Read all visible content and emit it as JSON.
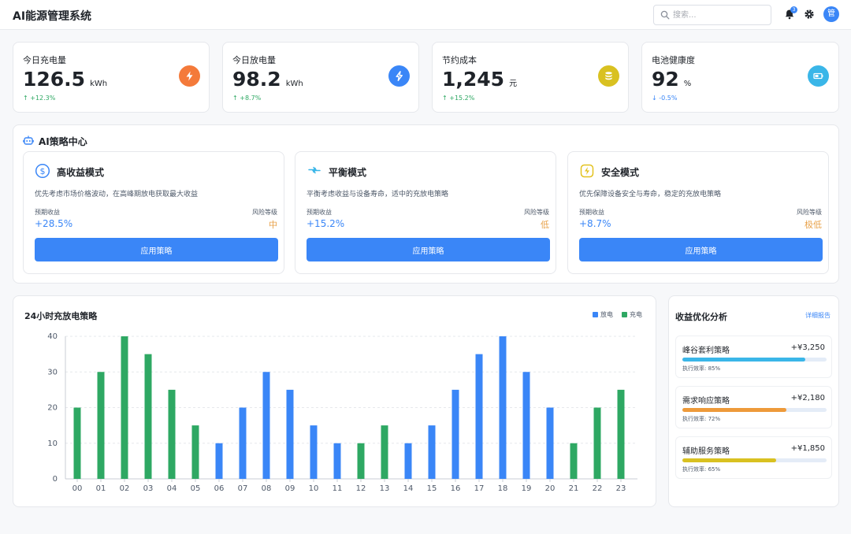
{
  "app": {
    "title": "AI能源管理系统"
  },
  "header": {
    "search_placeholder": "搜索...",
    "notification_count": "3",
    "avatar_text": "管"
  },
  "stats": [
    {
      "label": "今日充电量",
      "value": "126.5",
      "unit": "kWh",
      "trend": "+12.3%",
      "direction": "up",
      "icon": "bolt-icon",
      "color": "#f47a3a"
    },
    {
      "label": "今日放电量",
      "value": "98.2",
      "unit": "kWh",
      "trend": "+8.7%",
      "direction": "up",
      "icon": "flash-icon",
      "color": "#3a86f7"
    },
    {
      "label": "节约成本",
      "value": "1,245",
      "unit": "元",
      "trend": "+15.2%",
      "direction": "up",
      "icon": "coins-icon",
      "color": "#d9c121"
    },
    {
      "label": "电池健康度",
      "value": "92",
      "unit": "%",
      "trend": "-0.5%",
      "direction": "down",
      "icon": "battery-icon",
      "color": "#3ab6e8"
    }
  ],
  "ai_center": {
    "title": "AI策略中心",
    "strategies": [
      {
        "title": "高收益模式",
        "icon": "dollar-icon",
        "icon_color": "#3a86f7",
        "desc": "优先考虑市场价格波动，在高峰期放电获取最大收益",
        "income_label": "预期收益",
        "income": "+28.5%",
        "risk_label": "风险等级",
        "risk": "中",
        "button": "应用策略"
      },
      {
        "title": "平衡模式",
        "icon": "arrows-exchange-icon",
        "icon_color": "#3ab6e8",
        "desc": "平衡考虑收益与设备寿命，适中的充放电策略",
        "income_label": "预期收益",
        "income": "+15.2%",
        "risk_label": "风险等级",
        "risk": "低",
        "button": "应用策略"
      },
      {
        "title": "安全模式",
        "icon": "shield-bolt-icon",
        "icon_color": "#e3c21f",
        "desc": "优先保障设备安全与寿命，稳定的充放电策略",
        "income_label": "预期收益",
        "income": "+8.7%",
        "risk_label": "风险等级",
        "risk": "极低",
        "button": "应用策略"
      }
    ]
  },
  "chart": {
    "title": "24小时充放电策略",
    "legend": [
      {
        "name": "放电",
        "color": "#3a86f7"
      },
      {
        "name": "充电",
        "color": "#2ea863"
      }
    ]
  },
  "chart_data": {
    "type": "bar",
    "title": "24小时充放电策略",
    "categories": [
      "00",
      "01",
      "02",
      "03",
      "04",
      "05",
      "06",
      "07",
      "08",
      "09",
      "10",
      "11",
      "12",
      "13",
      "14",
      "15",
      "16",
      "17",
      "18",
      "19",
      "20",
      "21",
      "22",
      "23"
    ],
    "values": [
      20,
      30,
      40,
      35,
      25,
      15,
      10,
      20,
      30,
      25,
      15,
      10,
      10,
      15,
      10,
      15,
      25,
      35,
      40,
      30,
      20,
      10,
      20,
      25
    ],
    "bar_series": [
      "充电",
      "充电",
      "充电",
      "充电",
      "充电",
      "充电",
      "放电",
      "放电",
      "放电",
      "放电",
      "放电",
      "放电",
      "充电",
      "充电",
      "放电",
      "放电",
      "放电",
      "放电",
      "放电",
      "放电",
      "放电",
      "充电",
      "充电",
      "充电"
    ],
    "series": [
      {
        "name": "放电",
        "color": "#3a86f7"
      },
      {
        "name": "充电",
        "color": "#2ea863"
      }
    ],
    "yticks": [
      0,
      10,
      20,
      30,
      40
    ],
    "ylim": [
      0,
      40
    ],
    "grid": true,
    "legend_position": "top-right"
  },
  "revenue": {
    "title": "收益优化分析",
    "link": "详细报告",
    "items": [
      {
        "name": "峰谷套利策略",
        "amount": "+¥3,250",
        "efficiency_text": "执行效率: 85%",
        "efficiency": 0.85,
        "color": "#3ab6e8"
      },
      {
        "name": "需求响应策略",
        "amount": "+¥2,180",
        "efficiency_text": "执行效率: 72%",
        "efficiency": 0.72,
        "color": "#ee9a3a"
      },
      {
        "name": "辅助服务策略",
        "amount": "+¥1,850",
        "efficiency_text": "执行效率: 65%",
        "efficiency": 0.65,
        "color": "#d9c121"
      }
    ]
  }
}
